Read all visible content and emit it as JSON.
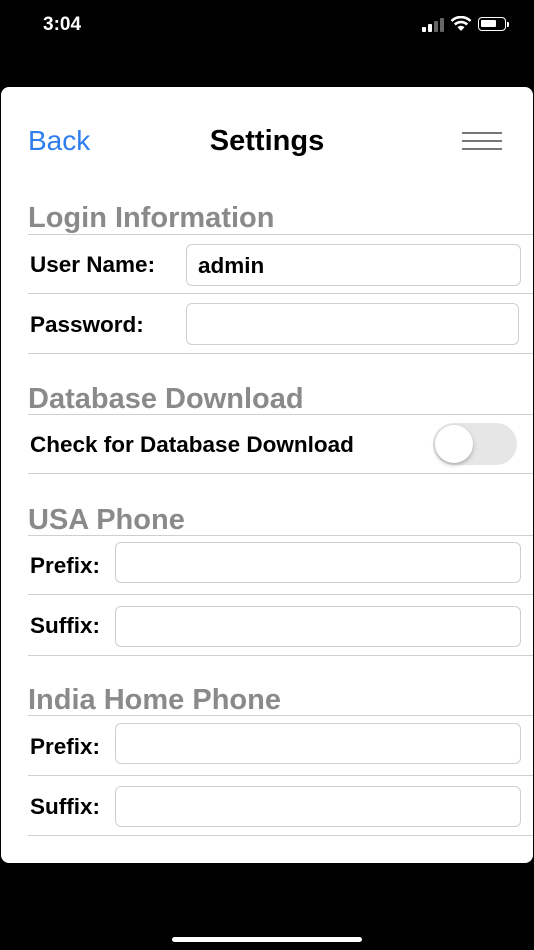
{
  "status_bar": {
    "time": "3:04"
  },
  "nav": {
    "back_label": "Back",
    "title": "Settings",
    "menu_icon": "hamburger-menu-icon"
  },
  "login": {
    "section_title": "Login Information",
    "user_name_label": "User Name:",
    "user_name_value": "admin",
    "password_label": "Password:",
    "password_value": ""
  },
  "database": {
    "section_title": "Database Download",
    "check_label": "Check for Database Download",
    "toggle_on": false
  },
  "usa_phone": {
    "section_title": "USA Phone",
    "prefix_label": "Prefix:",
    "prefix_value": "",
    "suffix_label": "Suffix:",
    "suffix_value": ""
  },
  "india_phone": {
    "section_title": "India Home Phone",
    "prefix_label": "Prefix:",
    "prefix_value": "",
    "suffix_label": "Suffix:",
    "suffix_value": ""
  }
}
